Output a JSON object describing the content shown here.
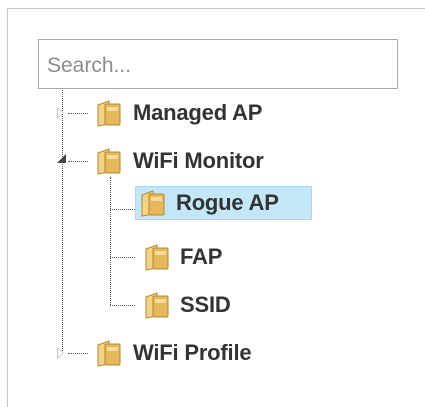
{
  "search": {
    "placeholder": "Search..."
  },
  "tree": {
    "nodes": [
      {
        "id": "managed-ap",
        "label": "Managed AP",
        "expanded": false,
        "level": 0
      },
      {
        "id": "wifi-monitor",
        "label": "WiFi Monitor",
        "expanded": true,
        "level": 0,
        "children": [
          {
            "id": "rogue-ap",
            "label": "Rogue AP",
            "selected": true
          },
          {
            "id": "fap",
            "label": "FAP"
          },
          {
            "id": "ssid",
            "label": "SSID"
          }
        ]
      },
      {
        "id": "wifi-profile",
        "label": "WiFi Profile",
        "expanded": false,
        "level": 0
      }
    ]
  },
  "colors": {
    "selection_bg": "#c4e7f7",
    "folder": "#e6b85a",
    "text": "#333333"
  },
  "icons": [
    "folder-icon",
    "expand-triangle-icon",
    "collapse-triangle-icon"
  ]
}
